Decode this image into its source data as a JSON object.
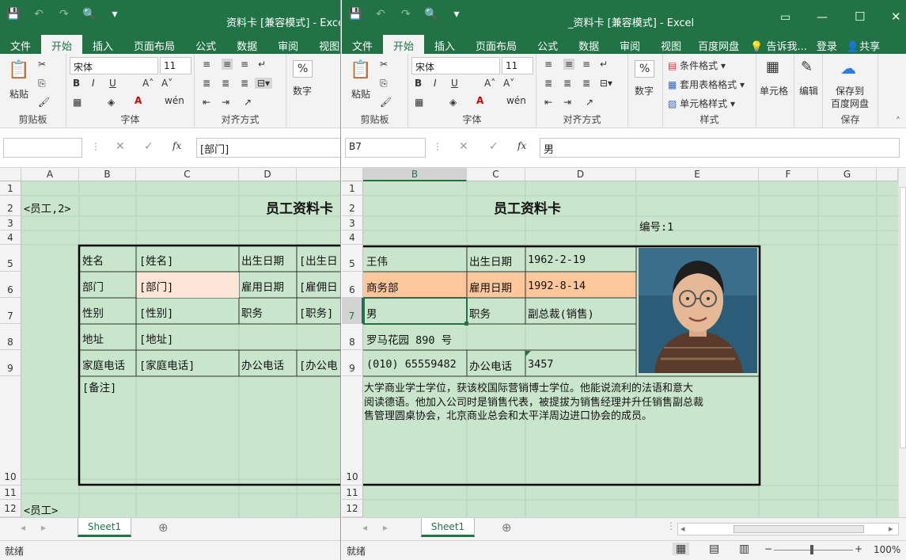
{
  "left": {
    "title": "资料卡  [兼容模式] - Excel",
    "tabs": [
      "文件",
      "开始",
      "插入",
      "页面布局",
      "公式",
      "数据",
      "审阅",
      "视图"
    ],
    "font_name": "宋体",
    "font_size": "11",
    "name_box": "",
    "formula": "[部门]",
    "cols": [
      "A",
      "B",
      "C",
      "D"
    ],
    "groups": {
      "clipboard": "剪贴板",
      "font": "字体",
      "align": "对齐方式"
    },
    "paste": "粘贴",
    "number": "数字",
    "a2": "<员工,2>",
    "title_cell": "员工资料卡",
    "a12": "<员工>",
    "labels": [
      "姓名",
      "部门",
      "性别",
      "地址",
      "家庭电话"
    ],
    "fields": [
      "[姓名]",
      "[部门]",
      "[性别]",
      "[地址]",
      "[家庭电话]"
    ],
    "labels2": [
      "出生日期",
      "雇用日期",
      "职务",
      "办公电话"
    ],
    "fields2": [
      "[出生日",
      "[雇佣日",
      "[职务]",
      "[办公电"
    ],
    "notes": "[备注]",
    "sheet": "Sheet1",
    "status": "就绪"
  },
  "right": {
    "title": "_资料卡  [兼容模式] - Excel",
    "tabs": [
      "文件",
      "开始",
      "插入",
      "页面布局",
      "公式",
      "数据",
      "审阅",
      "视图",
      "百度网盘"
    ],
    "tell": "告诉我...",
    "login": "登录",
    "share": "共享",
    "font_name": "宋体",
    "font_size": "11",
    "name_box": "B7",
    "formula": "男",
    "cols": [
      "B",
      "C",
      "D",
      "E",
      "F",
      "G"
    ],
    "groups": {
      "clipboard": "剪贴板",
      "font": "字体",
      "align": "对齐方式",
      "styles": "样式",
      "save": "保存"
    },
    "paste": "粘贴",
    "number": "数字",
    "cond_format": "条件格式",
    "table_format": "套用表格格式",
    "cell_style": "单元格样式",
    "cells": "单元格",
    "edit": "编辑",
    "save_baidu_1": "保存到",
    "save_baidu_2": "百度网盘",
    "title_cell": "员工资料卡",
    "number_label": "编号:1",
    "name": "王伟",
    "birth_label": "出生日期",
    "birth": "1962-2-19",
    "dept": "商务部",
    "hire_label": "雇用日期",
    "hire": "1992-8-14",
    "sex": "男",
    "job_label": "职务",
    "job": "副总裁(销售)",
    "address": "罗马花园 890 号",
    "home_phone": "(010) 65559482",
    "office_label": "办公电话",
    "office": "3457",
    "notes1": "大学商业学士学位，获该校国际营销博士学位。他能说流利的法语和意大",
    "notes2": "阅读德语。他加入公司时是销售代表，被提拔为销售经理并升任销售副总裁",
    "notes3": "售管理圆桌协会，北京商业总会和太平洋周边进口协会的成员。",
    "sheet": "Sheet1",
    "status": "就绪",
    "zoom": "100%"
  },
  "rows": [
    "1",
    "2",
    "3",
    "4",
    "5",
    "6",
    "7",
    "8",
    "9",
    "10",
    "11",
    "12"
  ],
  "colors": {
    "excel_green": "#217346",
    "sheet_bg": "#c9e6cd",
    "highlight_peach": "#fcc89b",
    "highlight_pink": "#fde5d8"
  }
}
